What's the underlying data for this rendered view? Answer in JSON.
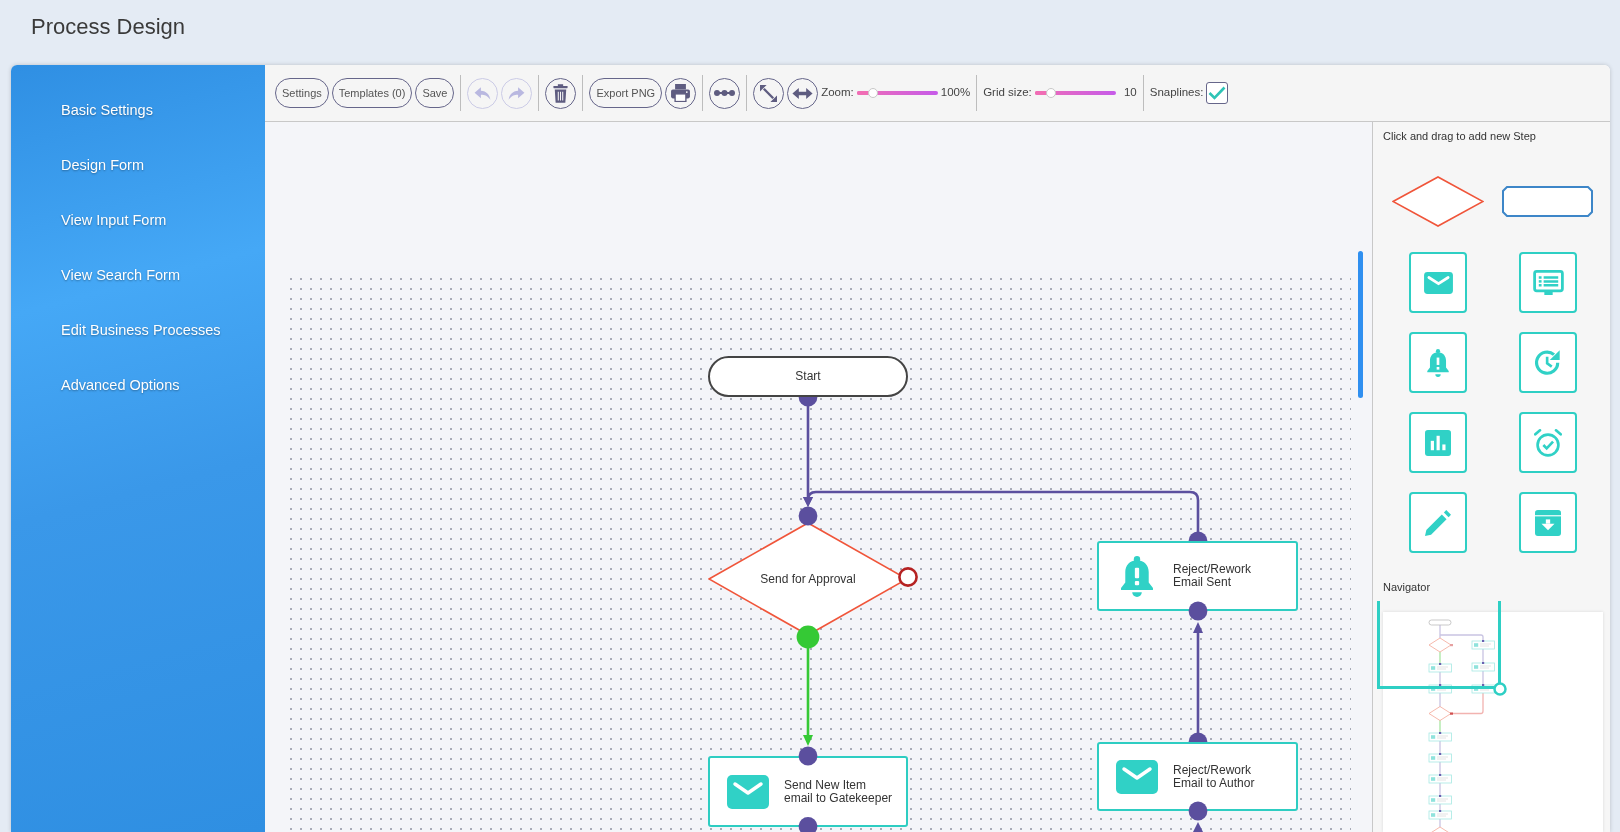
{
  "header": {
    "title": "Process Design"
  },
  "sidebar": {
    "items": [
      {
        "label": "Basic Settings"
      },
      {
        "label": "Design Form"
      },
      {
        "label": "View Input Form"
      },
      {
        "label": "View Search Form"
      },
      {
        "label": "Edit Business Processes"
      },
      {
        "label": "Advanced Options"
      }
    ]
  },
  "toolbar": {
    "groups": [
      {
        "items": [
          {
            "kind": "text",
            "label": "Settings",
            "disabled": false
          },
          {
            "kind": "text",
            "label": "Templates (0)",
            "disabled": false
          },
          {
            "kind": "text",
            "label": "Save",
            "disabled": false
          }
        ]
      },
      {
        "items": [
          {
            "kind": "undo",
            "disabled": true
          },
          {
            "kind": "redo",
            "disabled": true
          }
        ]
      },
      {
        "items": [
          {
            "kind": "delete",
            "disabled": false
          }
        ]
      },
      {
        "items": [
          {
            "kind": "text",
            "label": "Export PNG",
            "disabled": false
          },
          {
            "kind": "print",
            "disabled": false
          }
        ]
      },
      {
        "items": [
          {
            "kind": "connector",
            "disabled": false
          }
        ]
      },
      {
        "items": [
          {
            "kind": "fit",
            "disabled": false
          },
          {
            "kind": "stretch",
            "disabled": false
          },
          {
            "kind": "slider",
            "label": "Zoom:",
            "level": 0.2,
            "reading": "100%",
            "disabled": false
          }
        ]
      },
      {
        "items": [
          {
            "kind": "slider",
            "label": "Grid size:",
            "level": 0.2,
            "reading": "10",
            "disabled": false
          }
        ]
      },
      {
        "items": [
          {
            "kind": "checkbox",
            "label": "Snaplines:",
            "checked": true,
            "disabled": false
          }
        ]
      }
    ]
  },
  "canvas": {
    "nodes": [
      {
        "kind": "terminal",
        "label": "Start"
      },
      {
        "kind": "decision",
        "label": "Send for Approval"
      },
      {
        "kind": "email",
        "label": "Send New Item\nemail to Gatekeeper"
      },
      {
        "kind": "alert",
        "label": "Reject/Rework\nEmail Sent"
      },
      {
        "kind": "email",
        "label": "Reject/Rework\nEmail to Author"
      }
    ],
    "connectors": [
      {
        "color": "#5b4f9e"
      },
      {
        "color": "#5b4f9e"
      },
      {
        "color": "#35c935"
      },
      {
        "color": "#5b4f9e"
      },
      {
        "color": "#5b4f9e"
      }
    ]
  },
  "step_palette": {
    "hint": "Click and drag to add new Step"
  },
  "navigator": {
    "title": "Navigator"
  }
}
